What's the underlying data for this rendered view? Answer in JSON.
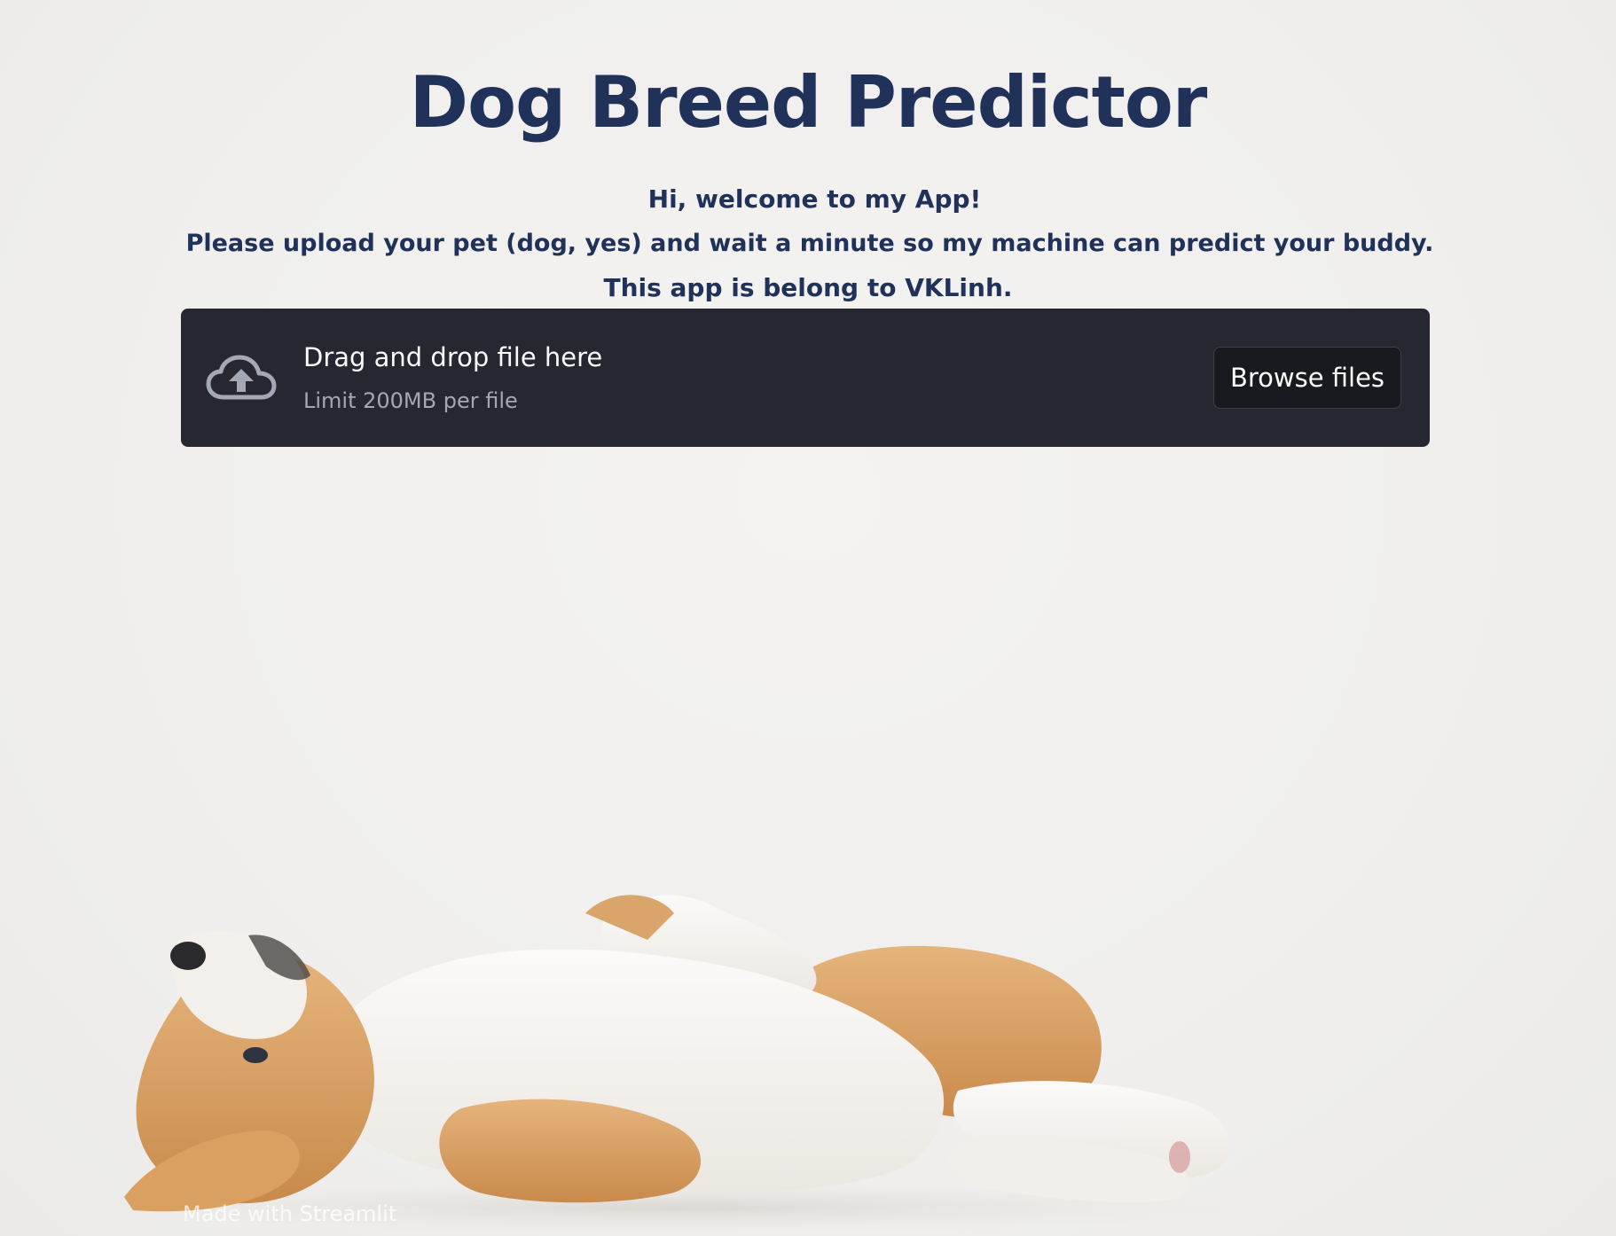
{
  "app": {
    "title": "Dog Breed Predictor"
  },
  "intro": {
    "line1": "Hi, welcome to my App!",
    "line2": "Please upload your pet (dog, yes) and wait a minute so my machine can predict your buddy.",
    "line3": "This app is belong to VKLinh."
  },
  "uploader": {
    "drag_text": "Drag and drop file here",
    "limit_text": "Limit 200MB per file",
    "browse_label": "Browse files",
    "icon": "cloud-upload-icon"
  },
  "footer": {
    "prefix": "Made with ",
    "brand": "Streamlit"
  },
  "colors": {
    "background": "#f1f0ee",
    "heading": "#20325a",
    "uploader_bg": "#262730",
    "button_bg": "#181a20"
  }
}
